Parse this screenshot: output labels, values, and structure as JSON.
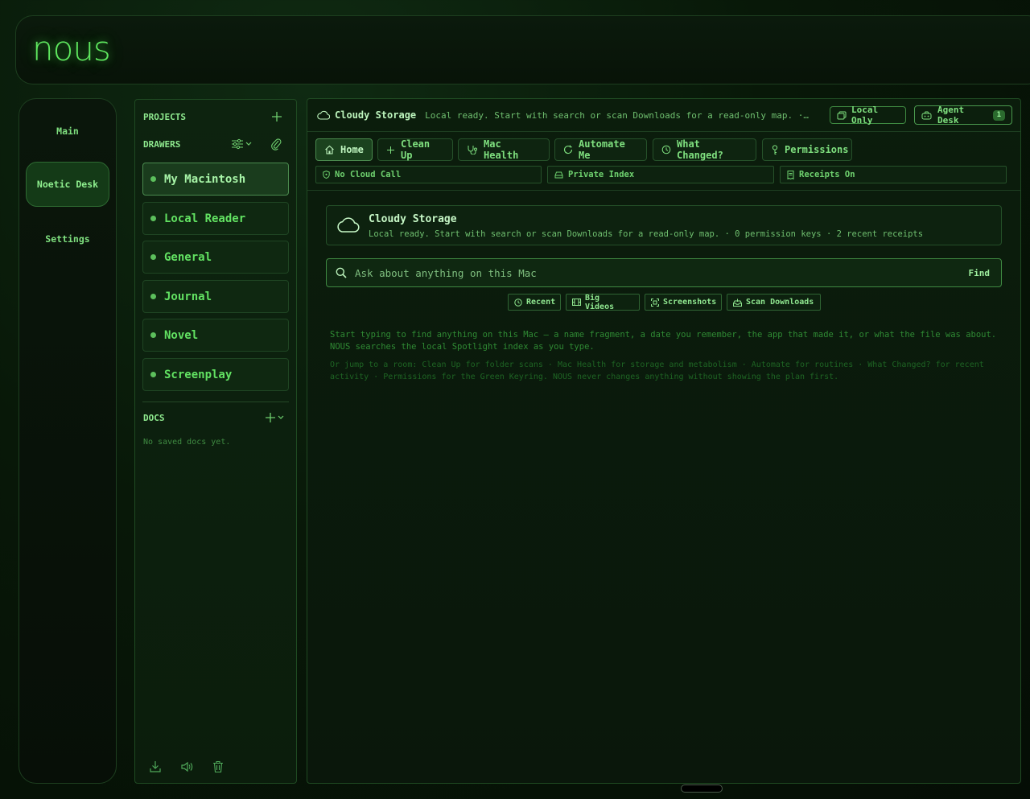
{
  "app": {
    "logo": "nous"
  },
  "nav": {
    "items": [
      {
        "label": "Main",
        "active": false
      },
      {
        "label": "Noetic Desk",
        "active": true
      },
      {
        "label": "Settings",
        "active": false
      }
    ]
  },
  "projects": {
    "title": "PROJECTS",
    "drawers_title": "DRAWERS",
    "drawers": [
      {
        "label": "My Macintosh",
        "active": true
      },
      {
        "label": "Local Reader",
        "active": false
      },
      {
        "label": "General",
        "active": false
      },
      {
        "label": "Journal",
        "active": false
      },
      {
        "label": "Novel",
        "active": false
      },
      {
        "label": "Screenplay",
        "active": false
      }
    ],
    "docs_title": "DOCS",
    "docs_empty": "No saved docs yet."
  },
  "header": {
    "title": "Cloudy Storage",
    "status": "Local ready. Start with search or scan Downloads for a read-only map. · 0 p…",
    "local_only": "Local Only",
    "agent_desk": "Agent Desk",
    "agent_badge": "1"
  },
  "tabs": [
    {
      "label": "Home",
      "icon": "home-icon",
      "active": true
    },
    {
      "label": "Clean Up",
      "icon": "sparkle-icon",
      "active": false
    },
    {
      "label": "Mac Health",
      "icon": "stethoscope-icon",
      "active": false
    },
    {
      "label": "Automate Me",
      "icon": "refresh-icon",
      "active": false
    },
    {
      "label": "What Changed?",
      "icon": "history-icon",
      "active": false
    },
    {
      "label": "Permissions",
      "icon": "key-icon",
      "active": false
    }
  ],
  "chips": [
    {
      "label": "No Cloud Call",
      "icon": "shield-icon"
    },
    {
      "label": "Private Index",
      "icon": "drive-icon"
    },
    {
      "label": "Receipts On",
      "icon": "receipt-icon"
    }
  ],
  "storage_card": {
    "title": "Cloudy Storage",
    "subtitle": "Local ready. Start with search or scan Downloads for a read-only map. · 0 permission keys · 2 recent receipts"
  },
  "search": {
    "placeholder": "Ask about anything on this Mac",
    "button": "Find"
  },
  "quick": [
    {
      "label": "Recent",
      "icon": "clock-icon"
    },
    {
      "label": "Big Videos",
      "icon": "film-icon"
    },
    {
      "label": "Screenshots",
      "icon": "screenshot-icon"
    },
    {
      "label": "Scan Downloads",
      "icon": "tray-icon"
    }
  ],
  "help": {
    "p1": "Start typing to find anything on this Mac — a name fragment, a date you remember, the app that made it, or what the file was about. NOUS searches the local Spotlight index as you type.",
    "p2": "Or jump to a room: Clean Up for folder scans · Mac Health for storage and metabolism · Automate for routines · What Changed? for recent activity · Permissions for the Green Keyring. NOUS never changes anything without showing the plan first."
  },
  "colors": {
    "accent": "#5fe85f",
    "panel_bg": "#0b1d0c",
    "border": "#1f4a22"
  }
}
